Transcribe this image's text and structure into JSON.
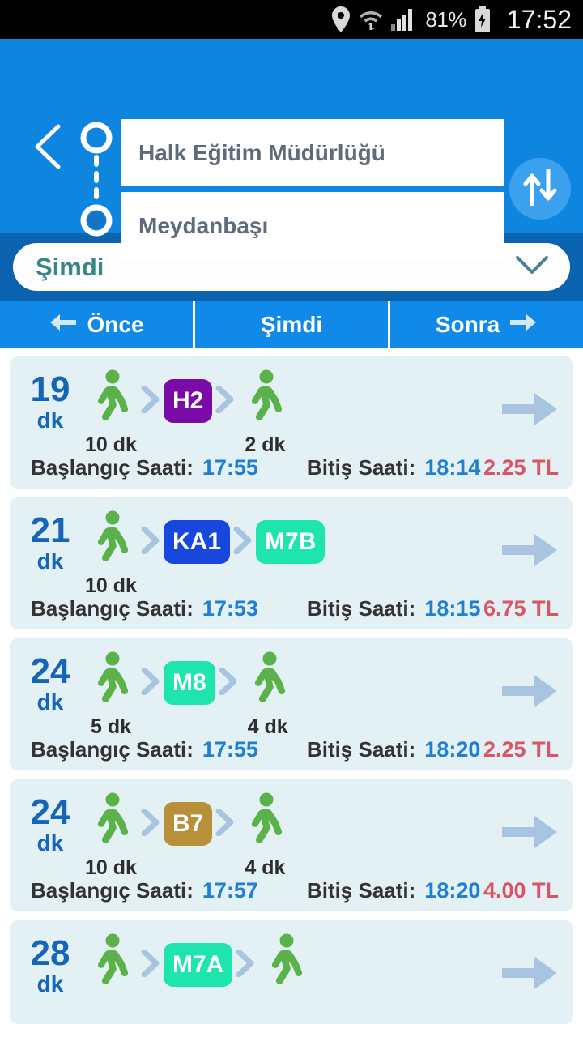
{
  "statusbar": {
    "battery_pct": "81%",
    "clock": "17:52",
    "icons": [
      "location-pin-icon",
      "wifi-icon",
      "signal-bars-icon",
      "battery-charging-icon"
    ]
  },
  "header": {
    "back_label": "back-chevron-icon",
    "origin": "Halk Eğitim Müdürlüğü",
    "destination": "Meydanbaşı",
    "swap_label": "swap-arrows-icon",
    "bg_color": "#0e86e0"
  },
  "time_filter": {
    "selected": "Şimdi",
    "chevron": "chevron-down-icon",
    "band_color": "#0b63af",
    "text_color": "#35858a"
  },
  "nav": {
    "prev": "Önce",
    "now": "Şimdi",
    "next": "Sonra",
    "bg_color": "#1189e8"
  },
  "labels": {
    "start_time": "Başlangıç Saati:",
    "end_time": "Bitiş Saati:",
    "minutes_unit": "dk"
  },
  "routes": [
    {
      "duration": "19",
      "unit": "dk",
      "legs": [
        {
          "type": "walk",
          "label": "10 dk"
        },
        {
          "type": "line",
          "code": "H2",
          "color": "#7b0ba8"
        },
        {
          "type": "walk",
          "label": "2 dk"
        }
      ],
      "start": "17:55",
      "end": "18:14",
      "fare": "2.25 TL"
    },
    {
      "duration": "21",
      "unit": "dk",
      "legs": [
        {
          "type": "walk",
          "label": "10 dk"
        },
        {
          "type": "line",
          "code": "KA1",
          "color": "#1747dd"
        },
        {
          "type": "line",
          "code": "M7B",
          "color": "#1ee5ad"
        }
      ],
      "start": "17:53",
      "end": "18:15",
      "fare": "6.75 TL"
    },
    {
      "duration": "24",
      "unit": "dk",
      "legs": [
        {
          "type": "walk",
          "label": "5 dk"
        },
        {
          "type": "line",
          "code": "M8",
          "color": "#1ee5ad"
        },
        {
          "type": "walk",
          "label": "4 dk"
        }
      ],
      "start": "17:55",
      "end": "18:20",
      "fare": "2.25 TL"
    },
    {
      "duration": "24",
      "unit": "dk",
      "legs": [
        {
          "type": "walk",
          "label": "10 dk"
        },
        {
          "type": "line",
          "code": "B7",
          "color": "#b8903a"
        },
        {
          "type": "walk",
          "label": "4 dk"
        }
      ],
      "start": "17:57",
      "end": "18:20",
      "fare": "4.00 TL"
    },
    {
      "duration": "28",
      "unit": "dk",
      "legs": [
        {
          "type": "walk",
          "label": ""
        },
        {
          "type": "line",
          "code": "M7A",
          "color": "#1ee5ad"
        },
        {
          "type": "walk",
          "label": ""
        }
      ],
      "start": "",
      "end": "",
      "fare": ""
    }
  ],
  "colors": {
    "walk_green": "#5cb24a",
    "duration_blue": "#1565b8",
    "time_blue": "#1e7fd4",
    "fare_red": "#d95566",
    "card_bg": "#e3f0f4",
    "chevron_gray": "#a8c4e0"
  }
}
